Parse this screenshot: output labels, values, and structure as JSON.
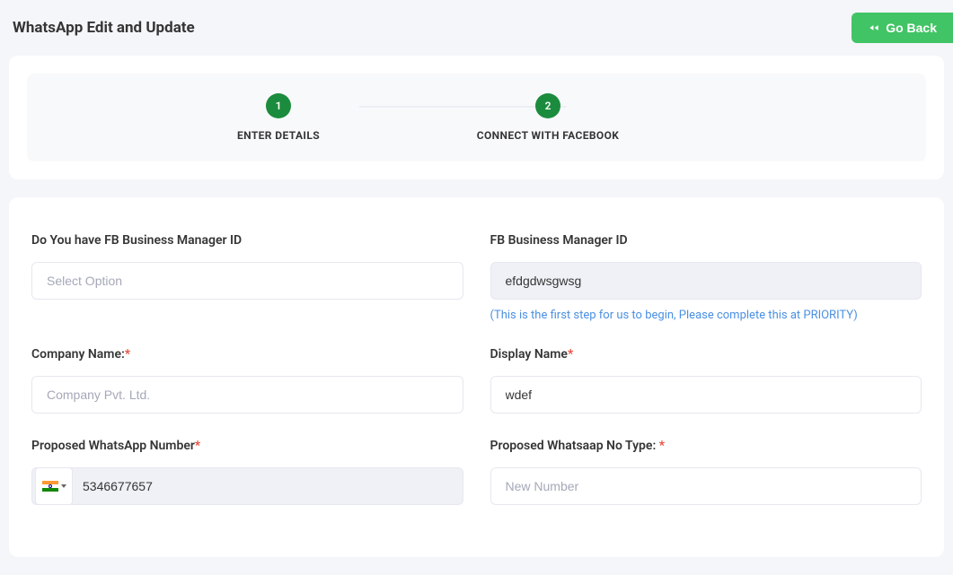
{
  "header": {
    "title": "WhatsApp Edit and Update",
    "go_back": "Go Back"
  },
  "stepper": {
    "steps": [
      {
        "number": "1",
        "label": "ENTER DETAILS"
      },
      {
        "number": "2",
        "label": "CONNECT WITH FACEBOOK"
      }
    ]
  },
  "form": {
    "fb_manager_question": {
      "label": "Do You have FB Business Manager ID",
      "placeholder": "Select Option"
    },
    "fb_manager_id": {
      "label": "FB Business Manager ID",
      "value": "efdgdwsgwsg",
      "helper": "(This is the first step for us to begin, Please complete this at PRIORITY)"
    },
    "company_name": {
      "label": "Company Name:",
      "placeholder": "Company Pvt. Ltd.",
      "value": ""
    },
    "display_name": {
      "label": "Display Name",
      "value": "wdef"
    },
    "proposed_whatsapp": {
      "label": "Proposed WhatsApp Number",
      "value": "5346677657",
      "country_flag": "india"
    },
    "proposed_whatsapp_type": {
      "label": "Proposed Whatsaap No Type: ",
      "placeholder": "New Number",
      "value": ""
    }
  }
}
